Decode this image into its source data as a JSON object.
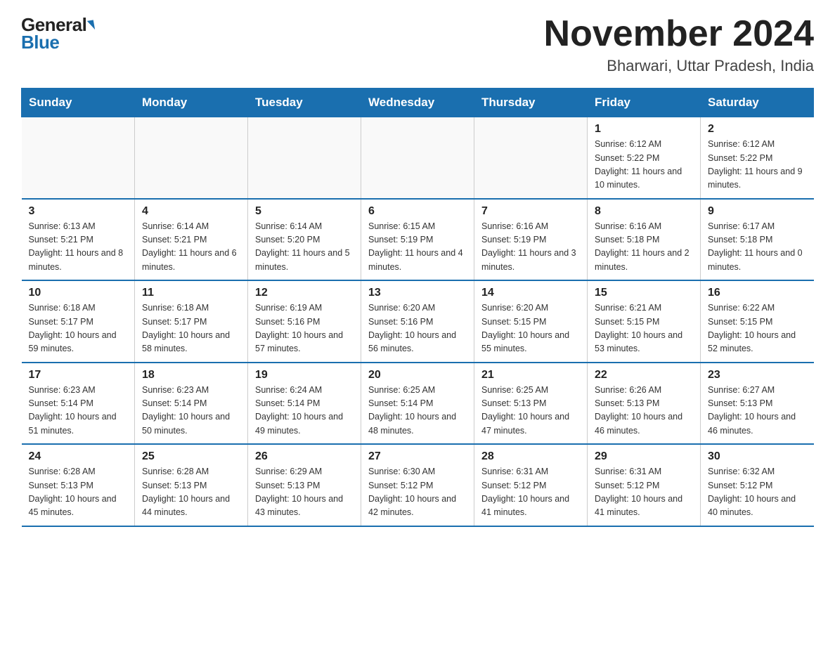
{
  "header": {
    "logo_general": "General",
    "logo_blue": "Blue",
    "month_title": "November 2024",
    "location": "Bharwari, Uttar Pradesh, India"
  },
  "weekdays": [
    "Sunday",
    "Monday",
    "Tuesday",
    "Wednesday",
    "Thursday",
    "Friday",
    "Saturday"
  ],
  "rows": [
    [
      {
        "day": "",
        "info": ""
      },
      {
        "day": "",
        "info": ""
      },
      {
        "day": "",
        "info": ""
      },
      {
        "day": "",
        "info": ""
      },
      {
        "day": "",
        "info": ""
      },
      {
        "day": "1",
        "info": "Sunrise: 6:12 AM\nSunset: 5:22 PM\nDaylight: 11 hours and 10 minutes."
      },
      {
        "day": "2",
        "info": "Sunrise: 6:12 AM\nSunset: 5:22 PM\nDaylight: 11 hours and 9 minutes."
      }
    ],
    [
      {
        "day": "3",
        "info": "Sunrise: 6:13 AM\nSunset: 5:21 PM\nDaylight: 11 hours and 8 minutes."
      },
      {
        "day": "4",
        "info": "Sunrise: 6:14 AM\nSunset: 5:21 PM\nDaylight: 11 hours and 6 minutes."
      },
      {
        "day": "5",
        "info": "Sunrise: 6:14 AM\nSunset: 5:20 PM\nDaylight: 11 hours and 5 minutes."
      },
      {
        "day": "6",
        "info": "Sunrise: 6:15 AM\nSunset: 5:19 PM\nDaylight: 11 hours and 4 minutes."
      },
      {
        "day": "7",
        "info": "Sunrise: 6:16 AM\nSunset: 5:19 PM\nDaylight: 11 hours and 3 minutes."
      },
      {
        "day": "8",
        "info": "Sunrise: 6:16 AM\nSunset: 5:18 PM\nDaylight: 11 hours and 2 minutes."
      },
      {
        "day": "9",
        "info": "Sunrise: 6:17 AM\nSunset: 5:18 PM\nDaylight: 11 hours and 0 minutes."
      }
    ],
    [
      {
        "day": "10",
        "info": "Sunrise: 6:18 AM\nSunset: 5:17 PM\nDaylight: 10 hours and 59 minutes."
      },
      {
        "day": "11",
        "info": "Sunrise: 6:18 AM\nSunset: 5:17 PM\nDaylight: 10 hours and 58 minutes."
      },
      {
        "day": "12",
        "info": "Sunrise: 6:19 AM\nSunset: 5:16 PM\nDaylight: 10 hours and 57 minutes."
      },
      {
        "day": "13",
        "info": "Sunrise: 6:20 AM\nSunset: 5:16 PM\nDaylight: 10 hours and 56 minutes."
      },
      {
        "day": "14",
        "info": "Sunrise: 6:20 AM\nSunset: 5:15 PM\nDaylight: 10 hours and 55 minutes."
      },
      {
        "day": "15",
        "info": "Sunrise: 6:21 AM\nSunset: 5:15 PM\nDaylight: 10 hours and 53 minutes."
      },
      {
        "day": "16",
        "info": "Sunrise: 6:22 AM\nSunset: 5:15 PM\nDaylight: 10 hours and 52 minutes."
      }
    ],
    [
      {
        "day": "17",
        "info": "Sunrise: 6:23 AM\nSunset: 5:14 PM\nDaylight: 10 hours and 51 minutes."
      },
      {
        "day": "18",
        "info": "Sunrise: 6:23 AM\nSunset: 5:14 PM\nDaylight: 10 hours and 50 minutes."
      },
      {
        "day": "19",
        "info": "Sunrise: 6:24 AM\nSunset: 5:14 PM\nDaylight: 10 hours and 49 minutes."
      },
      {
        "day": "20",
        "info": "Sunrise: 6:25 AM\nSunset: 5:14 PM\nDaylight: 10 hours and 48 minutes."
      },
      {
        "day": "21",
        "info": "Sunrise: 6:25 AM\nSunset: 5:13 PM\nDaylight: 10 hours and 47 minutes."
      },
      {
        "day": "22",
        "info": "Sunrise: 6:26 AM\nSunset: 5:13 PM\nDaylight: 10 hours and 46 minutes."
      },
      {
        "day": "23",
        "info": "Sunrise: 6:27 AM\nSunset: 5:13 PM\nDaylight: 10 hours and 46 minutes."
      }
    ],
    [
      {
        "day": "24",
        "info": "Sunrise: 6:28 AM\nSunset: 5:13 PM\nDaylight: 10 hours and 45 minutes."
      },
      {
        "day": "25",
        "info": "Sunrise: 6:28 AM\nSunset: 5:13 PM\nDaylight: 10 hours and 44 minutes."
      },
      {
        "day": "26",
        "info": "Sunrise: 6:29 AM\nSunset: 5:13 PM\nDaylight: 10 hours and 43 minutes."
      },
      {
        "day": "27",
        "info": "Sunrise: 6:30 AM\nSunset: 5:12 PM\nDaylight: 10 hours and 42 minutes."
      },
      {
        "day": "28",
        "info": "Sunrise: 6:31 AM\nSunset: 5:12 PM\nDaylight: 10 hours and 41 minutes."
      },
      {
        "day": "29",
        "info": "Sunrise: 6:31 AM\nSunset: 5:12 PM\nDaylight: 10 hours and 41 minutes."
      },
      {
        "day": "30",
        "info": "Sunrise: 6:32 AM\nSunset: 5:12 PM\nDaylight: 10 hours and 40 minutes."
      }
    ]
  ]
}
